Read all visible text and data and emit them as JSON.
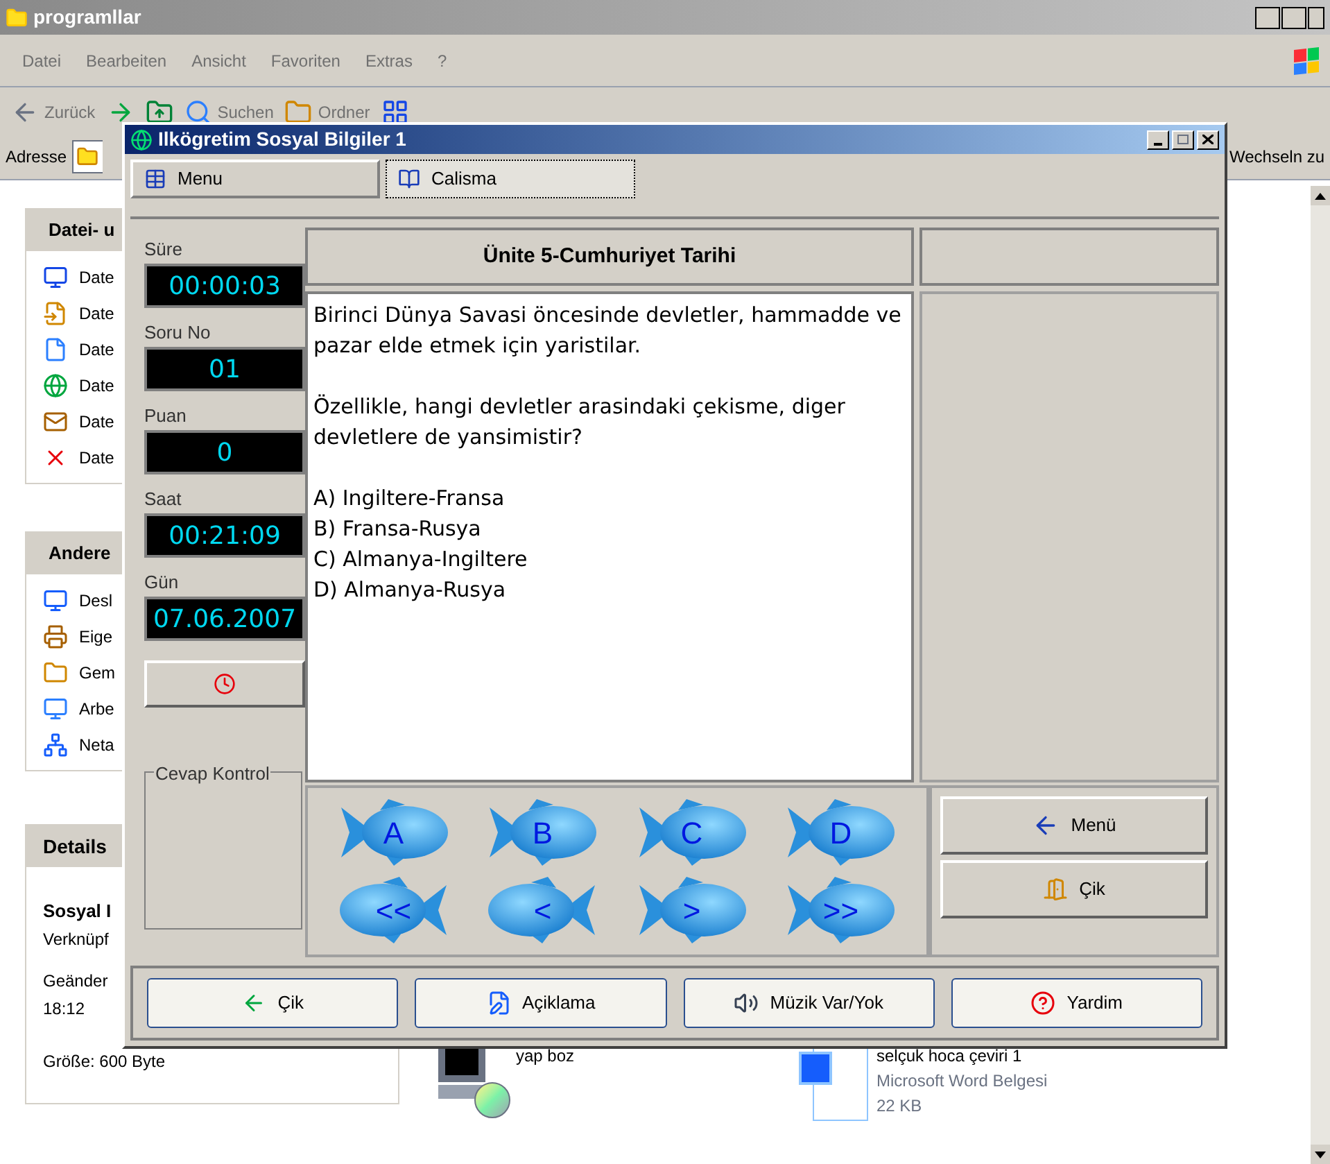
{
  "explorer": {
    "title": "programllar",
    "menu": [
      "Datei",
      "Bearbeiten",
      "Ansicht",
      "Favoriten",
      "Extras",
      "?"
    ],
    "toolbar": [
      {
        "label": "Zurück",
        "kind": "back"
      },
      {
        "kind": "forward"
      },
      {
        "kind": "up"
      },
      {
        "label": "Suchen",
        "kind": "search"
      },
      {
        "label": "Ordner",
        "kind": "folders"
      },
      {
        "kind": "views"
      }
    ],
    "address_label": "Adresse",
    "go_label": "Wechseln zu",
    "tasks": [
      {
        "title": "Datei- u",
        "items": [
          {
            "label": "Date",
            "kind": "publish"
          },
          {
            "label": "Date",
            "kind": "move"
          },
          {
            "label": "Date",
            "kind": "copy"
          },
          {
            "label": "Date",
            "kind": "web"
          },
          {
            "label": "Date",
            "kind": "mail"
          },
          {
            "label": "Date",
            "kind": "delete"
          }
        ]
      },
      {
        "title": "Andere",
        "items": [
          {
            "label": "Desl",
            "kind": "desktop"
          },
          {
            "label": "Eige",
            "kind": "docs"
          },
          {
            "label": "Gem",
            "kind": "folder"
          },
          {
            "label": "Arbe",
            "kind": "computer"
          },
          {
            "label": "Neta",
            "kind": "network"
          }
        ]
      }
    ],
    "details": {
      "title": "Details",
      "name": "Sosyal I",
      "type": "Verknüpf",
      "modified": [
        "Geänder",
        "18:12"
      ],
      "size": "Größe: 600 Byte"
    },
    "files": [
      {
        "kind": "setup",
        "lines": [
          "yap boz"
        ]
      },
      {
        "kind": "word",
        "lines": [
          "selçuk hoca çeviri 1",
          "Microsoft Word Belgesi",
          "22 KB"
        ]
      }
    ]
  },
  "app": {
    "title": "Ilkögretim Sosyal Bilgiler 1",
    "tabs": [
      {
        "label": "Menu",
        "kind": "menu",
        "selected": false
      },
      {
        "label": "Calisma",
        "kind": "study",
        "selected": true
      }
    ],
    "stats": [
      {
        "label": "Süre",
        "value": "00:00:03"
      },
      {
        "label": "Soru No",
        "value": "01"
      },
      {
        "label": "Puan",
        "value": "0"
      },
      {
        "label": "Saat",
        "value": "00:21:09"
      },
      {
        "label": "Gün",
        "value": "07.06.2007"
      }
    ],
    "answer_check_label": "Cevap Kontrol",
    "unit_title": "Ünite 5-Cumhuriyet Tarihi",
    "question": {
      "paragraphs": [
        "Birinci Dünya Savasi öncesinde devletler, hammadde ve pazar elde etmek için yaristilar.",
        "Özellikle, hangi devletler arasindaki çekisme, diger devletlere de yansimistir?"
      ],
      "options": [
        "A) Ingiltere-Fransa",
        "B) Fransa-Rusya",
        "C) Almanya-Ingiltere",
        "D) Almanya-Rusya"
      ]
    },
    "fish_buttons": [
      {
        "label": "A",
        "kind": "answer"
      },
      {
        "label": "B",
        "kind": "answer"
      },
      {
        "label": "C",
        "kind": "answer"
      },
      {
        "label": "D",
        "kind": "answer"
      },
      {
        "label": "<<",
        "kind": "back"
      },
      {
        "label": "<",
        "kind": "back"
      },
      {
        "label": ">",
        "kind": "forward"
      },
      {
        "label": ">>",
        "kind": "forward"
      }
    ],
    "side_buttons": [
      {
        "label": "Menü",
        "kind": "back"
      },
      {
        "label": "Çik",
        "kind": "door"
      }
    ],
    "bottom_buttons": [
      {
        "label": "Çik",
        "kind": "exit"
      },
      {
        "label": "Açiklama",
        "kind": "notes"
      },
      {
        "label": "Müzik Var/Yok",
        "kind": "sound"
      },
      {
        "label": "Yardim",
        "kind": "help"
      }
    ]
  }
}
